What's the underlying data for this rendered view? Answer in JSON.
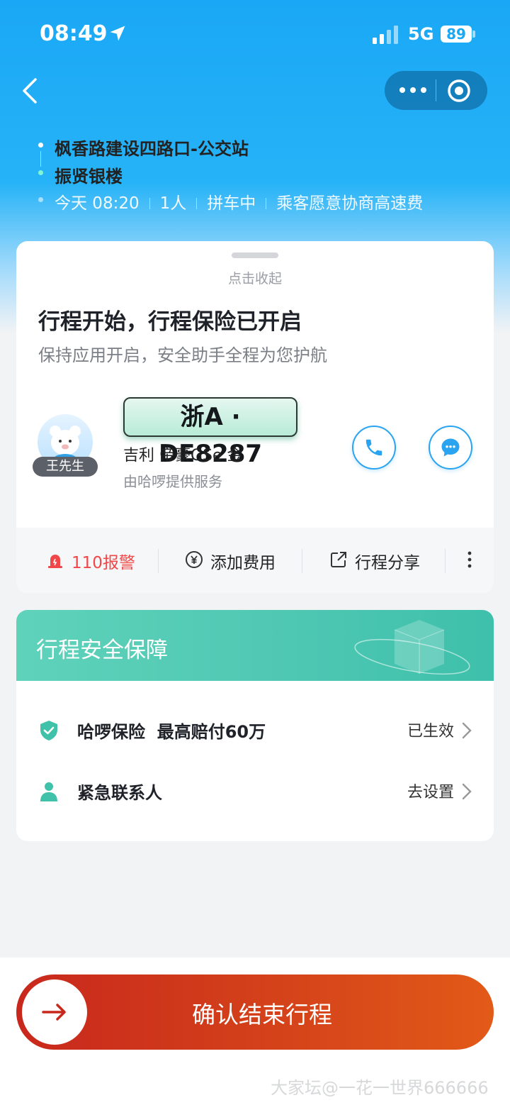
{
  "status_bar": {
    "time": "08:49",
    "network": "5G",
    "battery": "89"
  },
  "trip": {
    "from": "枫香路建设四路口-公交站",
    "to": "振贤银楼",
    "time": "今天 08:20",
    "passengers": "1人",
    "mode": "拼车中",
    "note": "乘客愿意协商高速费"
  },
  "panel": {
    "collapse_text": "点击收起",
    "headline": "行程开始，行程保险已开启",
    "subline": "保持应用开启，安全助手全程为您护航"
  },
  "driver": {
    "name": "王先生",
    "plate": "浙A · DE8287",
    "car_model": "吉利 帝豪GSe 金",
    "provider": "由哈啰提供服务"
  },
  "actions": {
    "police": "110报警",
    "add_fee": "添加费用",
    "share": "行程分享"
  },
  "safety": {
    "title": "行程安全保障",
    "insurance_label": "哈啰保险  最高赔付60万",
    "insurance_status": "已生效",
    "contact_label": "紧急联系人",
    "contact_status": "去设置"
  },
  "confirm_button": "确认结束行程",
  "watermark": "大家坛@一花一世界666666",
  "colors": {
    "primary_blue": "#1aa7f5",
    "accent_green": "#4fc8b3",
    "danger_red": "#f04848",
    "confirm_red": "#d4421a"
  },
  "icons": [
    "location-arrow-icon",
    "signal-icon",
    "back-chevron-icon",
    "more-dots-icon",
    "target-icon",
    "phone-icon",
    "chat-icon",
    "alarm-icon",
    "yuan-icon",
    "share-icon",
    "vertical-dots-icon",
    "shield-check-icon",
    "person-icon",
    "chevron-right-icon",
    "arrow-right-icon"
  ]
}
